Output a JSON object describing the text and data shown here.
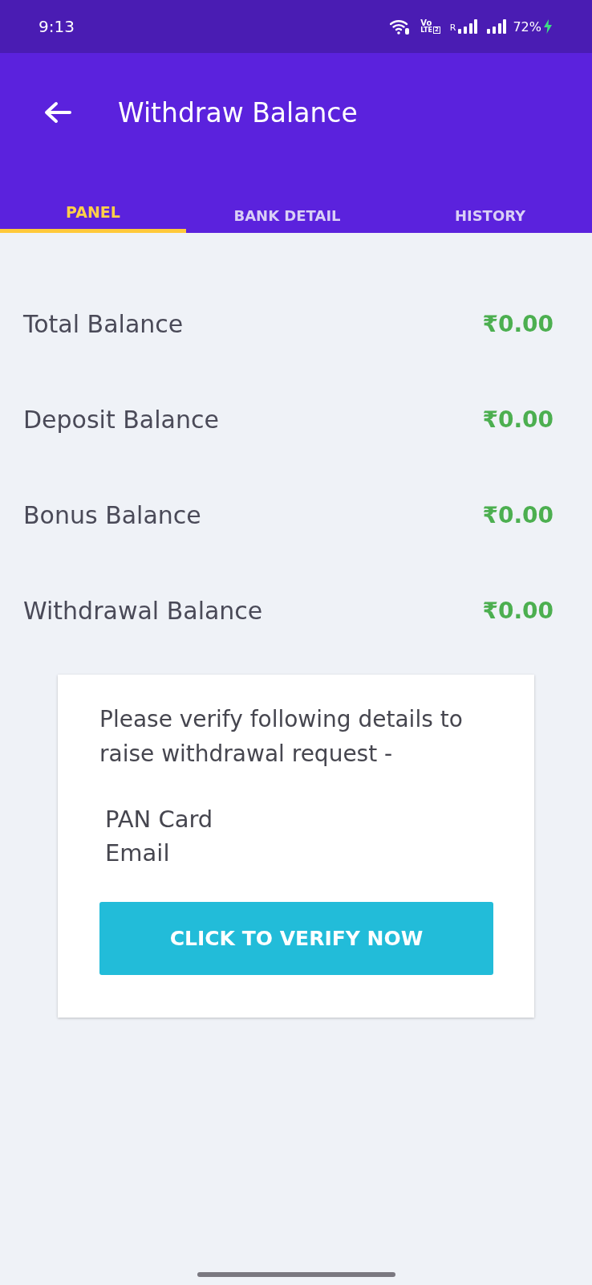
{
  "status_bar": {
    "time": "9:13",
    "volte_top": "Vo",
    "volte_bottom": "LTE",
    "sim_slot": "2",
    "roaming": "R",
    "battery": "72%",
    "charging": true
  },
  "app_bar": {
    "title": "Withdraw Balance"
  },
  "tabs": [
    {
      "label": "PANEL",
      "selected": true
    },
    {
      "label": "BANK DETAIL",
      "selected": false
    },
    {
      "label": "HISTORY",
      "selected": false
    }
  ],
  "balances": [
    {
      "label": "Total Balance",
      "amount": "₹0.00"
    },
    {
      "label": "Deposit Balance",
      "amount": "₹0.00"
    },
    {
      "label": "Bonus Balance",
      "amount": "₹0.00"
    },
    {
      "label": "Withdrawal Balance",
      "amount": "₹0.00"
    }
  ],
  "verify_card": {
    "message": "Please verify following details to raise withdrawal request -",
    "items": [
      "PAN Card",
      "Email"
    ],
    "button": "CLICK TO VERIFY NOW"
  }
}
